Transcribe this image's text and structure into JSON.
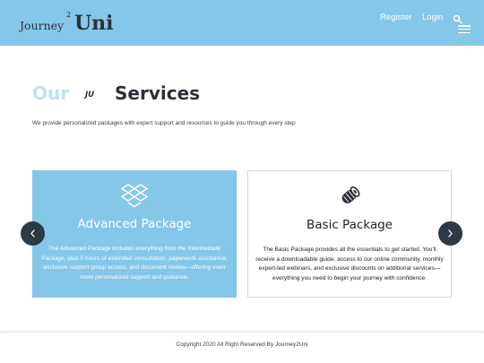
{
  "header": {
    "logo": {
      "journey": "Journey",
      "two": "2",
      "uni": "Uni"
    },
    "nav": {
      "register": "Register",
      "login": "Login"
    },
    "icons": {
      "search": "search-icon",
      "menu": "menu-icon"
    },
    "background_color": "#85c7e8"
  },
  "services": {
    "title_our": "Our",
    "title_logo": "JU",
    "title_services": "Services",
    "intro": "We provide personalized packages with expert support and resources to guide you through every step"
  },
  "packages": [
    {
      "icon": "dropbox-box-icon",
      "title": "Advanced Package",
      "description": "The Advanced Package includes everything from the Intermediate Package, plus 5 hours of extended consultation, paperwork assistance, exclusive support group access, and document review—offering even more personalized support and guidance."
    },
    {
      "icon": "rolled-map-icon",
      "title": "Basic Package",
      "description": "The Basic Package provides all the essentials to get started. You'll receive a downloadable guide, access to our online community, monthly expert-led webinars, and exclusive discounts on additional services—everything you need to begin your journey with confidence."
    }
  ],
  "carousel": {
    "prev_icon": "chevron-left-icon",
    "next_icon": "chevron-right-icon"
  },
  "footer": {
    "copyright": "Copyright 2020 All Right Reserved By Journey2Uni"
  }
}
